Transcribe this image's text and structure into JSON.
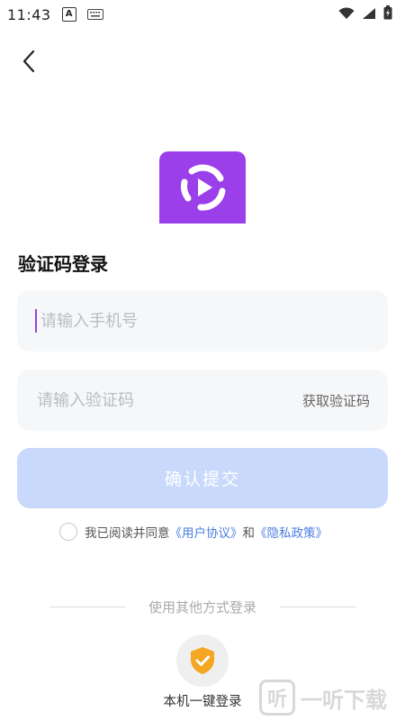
{
  "status_bar": {
    "time": "11:43",
    "icons": [
      "a-notification-icon",
      "keyboard-icon",
      "wifi-icon",
      "signal-icon",
      "battery-icon"
    ]
  },
  "nav": {
    "back_icon": "chevron-left-icon"
  },
  "app_logo": {
    "icon": "play-logo-icon",
    "color": "#9b3fea"
  },
  "login": {
    "title": "验证码登录",
    "phone_placeholder": "请输入手机号",
    "code_placeholder": "请输入验证码",
    "get_code": "获取验证码",
    "submit": "确认提交",
    "submit_color": "#c8d9fb"
  },
  "agreement": {
    "prefix": "我已阅读并同意",
    "user_agreement": "《用户协议》",
    "and": "和",
    "privacy_policy": "《隐私政策》",
    "link_color": "#4a7ee0"
  },
  "other_login": {
    "divider_text": "使用其他方式登录",
    "one_key_label": "本机一键登录",
    "one_key_icon": "shield-check-icon",
    "icon_color": "#f5a623"
  },
  "watermark": {
    "glyph": "听",
    "text": "一听下载"
  }
}
